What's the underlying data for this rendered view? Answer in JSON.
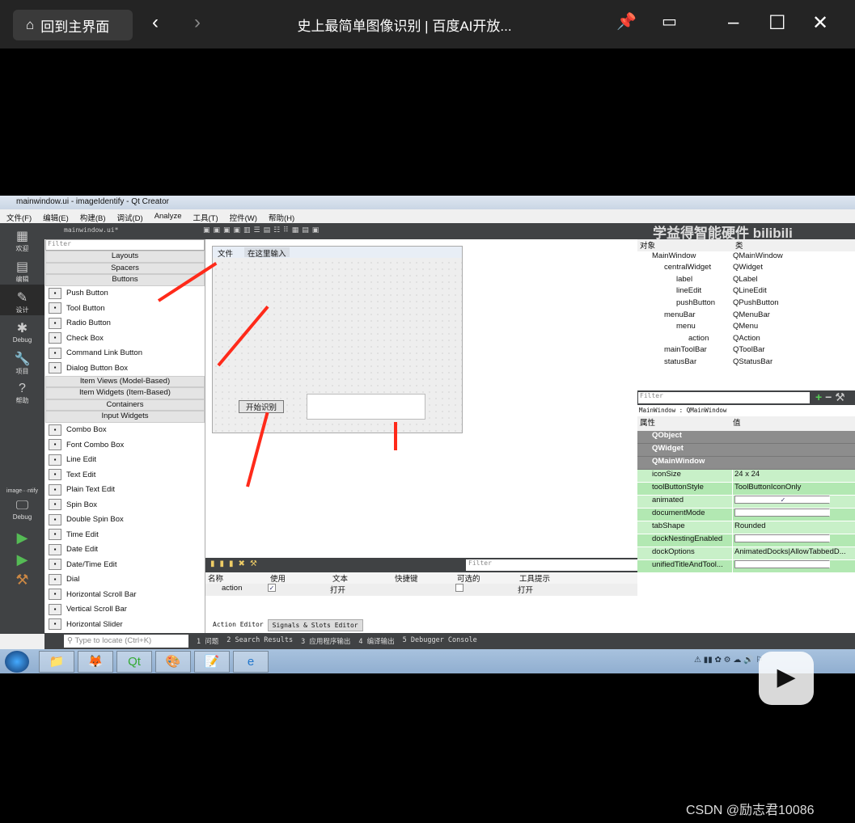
{
  "player": {
    "home_label": "回到主界面",
    "title": "史上最简单图像识别 | 百度AI开放...",
    "watermark": "CSDN @励志君10086",
    "icons": [
      "home-icon",
      "back-icon",
      "forward-icon",
      "pin-icon",
      "pip-icon",
      "minimize-icon",
      "maximize-icon",
      "close-icon",
      "play-icon"
    ]
  },
  "qt": {
    "title": "mainwindow.ui - imageIdentify - Qt Creator",
    "menu": [
      "文件(F)",
      "编辑(E)",
      "构建(B)",
      "调试(D)",
      "Analyze",
      "工具(T)",
      "控件(W)",
      "帮助(H)"
    ],
    "modes": [
      "欢迎",
      "编辑",
      "设计",
      "Debug",
      "项目",
      "帮助"
    ],
    "target_label": "image···ntify",
    "target_mode": "Debug",
    "open_file": "mainwindow.ui*",
    "brand": "学益得智能硬件 bilibili",
    "widget_filter": "Filter",
    "widget_box": [
      {
        "cat": "Layouts"
      },
      {
        "cat": "Spacers"
      },
      {
        "cat": "Buttons",
        "open": true,
        "items": [
          "Push Button",
          "Tool Button",
          "Radio Button",
          "Check Box",
          "Command Link Button",
          "Dialog Button Box"
        ]
      },
      {
        "cat": "Item Views (Model-Based)"
      },
      {
        "cat": "Item Widgets (Item-Based)"
      },
      {
        "cat": "Containers"
      },
      {
        "cat": "Input Widgets",
        "open": true,
        "items": [
          "Combo Box",
          "Font Combo Box",
          "Line Edit",
          "Text Edit",
          "Plain Text Edit",
          "Spin Box",
          "Double Spin Box",
          "Time Edit",
          "Date Edit",
          "Date/Time Edit",
          "Dial",
          "Horizontal Scroll Bar",
          "Vertical Scroll Bar",
          "Horizontal Slider"
        ]
      }
    ],
    "form": {
      "menu_file": "文件",
      "menu_placeholder": "在这里输入",
      "button": "开始识别"
    },
    "action_editor": {
      "filter": "Filter",
      "columns": [
        "名称",
        "使用",
        "文本",
        "快捷键",
        "可选的",
        "工具提示"
      ],
      "row": {
        "name": "action",
        "used": true,
        "text": "打开",
        "shortcut": "",
        "checkable": false,
        "tooltip": "打开"
      },
      "tabs": [
        "Action Editor",
        "Signals & Slots Editor"
      ]
    },
    "object_inspector": {
      "columns": [
        "对象",
        "类"
      ],
      "rows": [
        {
          "name": "MainWindow",
          "cls": "QMainWindow",
          "lvl": 0
        },
        {
          "name": "centralWidget",
          "cls": "QWidget",
          "lvl": 1
        },
        {
          "name": "label",
          "cls": "QLabel",
          "lvl": 2
        },
        {
          "name": "lineEdit",
          "cls": "QLineEdit",
          "lvl": 2
        },
        {
          "name": "pushButton",
          "cls": "QPushButton",
          "lvl": 2
        },
        {
          "name": "menuBar",
          "cls": "QMenuBar",
          "lvl": 1
        },
        {
          "name": "menu",
          "cls": "QMenu",
          "lvl": 2
        },
        {
          "name": "action",
          "cls": "QAction",
          "lvl": 3
        },
        {
          "name": "mainToolBar",
          "cls": "QToolBar",
          "lvl": 1
        },
        {
          "name": "statusBar",
          "cls": "QStatusBar",
          "lvl": 1
        }
      ]
    },
    "property_editor": {
      "filter": "Filter",
      "context": "MainWindow : QMainWindow",
      "columns": [
        "属性",
        "值"
      ],
      "groups": [
        "QObject",
        "QWidget",
        "QMainWindow"
      ],
      "rows": [
        {
          "name": "iconSize",
          "value": "24 x 24"
        },
        {
          "name": "toolButtonStyle",
          "value": "ToolButtonIconOnly"
        },
        {
          "name": "animated",
          "check": true
        },
        {
          "name": "documentMode",
          "check": false
        },
        {
          "name": "tabShape",
          "value": "Rounded"
        },
        {
          "name": "dockNestingEnabled",
          "check": false
        },
        {
          "name": "dockOptions",
          "value": "AnimatedDocks|AllowTabbedD..."
        },
        {
          "name": "unifiedTitleAndTool...",
          "check": false
        }
      ]
    },
    "locator": {
      "placeholder": "Type to locate (Ctrl+K)",
      "panes": [
        "1 问题",
        "2 Search Results",
        "3 应用程序输出",
        "4 编译输出",
        "5 Debugger Console"
      ]
    }
  },
  "colors": {
    "arrow": "#ff2a1a",
    "property_green": "#c8f0c8",
    "group_gray": "#8d8d8d",
    "ide_dark": "#404244"
  }
}
